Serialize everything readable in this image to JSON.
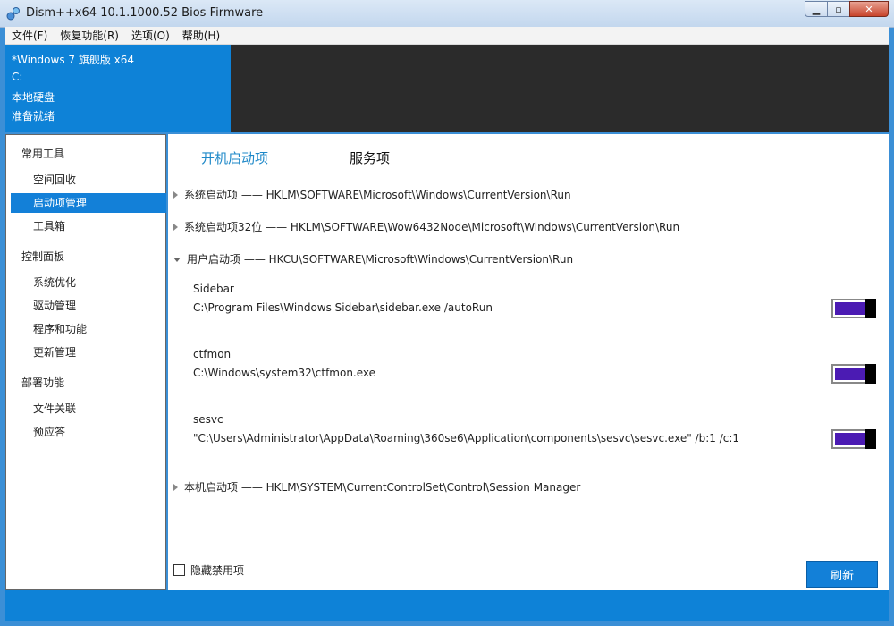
{
  "window": {
    "title": "Dism++x64 10.1.1000.52 Bios Firmware"
  },
  "menu": [
    "文件(F)",
    "恢复功能(R)",
    "选项(O)",
    "帮助(H)"
  ],
  "info": {
    "os": "*Windows 7 旗舰版 x64",
    "drive": "C:",
    "disk": "本地硬盘",
    "status": "准备就绪"
  },
  "sidebar": {
    "sections": [
      {
        "title": "常用工具",
        "items": [
          "空间回收",
          "启动项管理",
          "工具箱"
        ]
      },
      {
        "title": "控制面板",
        "items": [
          "系统优化",
          "驱动管理",
          "程序和功能",
          "更新管理"
        ]
      },
      {
        "title": "部署功能",
        "items": [
          "文件关联",
          "预应答"
        ]
      }
    ],
    "active": "启动项管理"
  },
  "tabs": [
    "开机启动项",
    "服务项"
  ],
  "groups": [
    {
      "label": "系统启动项 —— HKLM\\SOFTWARE\\Microsoft\\Windows\\CurrentVersion\\Run",
      "expanded": false
    },
    {
      "label": "系统启动项32位 —— HKLM\\SOFTWARE\\Wow6432Node\\Microsoft\\Windows\\CurrentVersion\\Run",
      "expanded": false
    },
    {
      "label": "用户启动项 —— HKCU\\SOFTWARE\\Microsoft\\Windows\\CurrentVersion\\Run",
      "expanded": true
    },
    {
      "label": "本机启动项 —— HKLM\\SYSTEM\\CurrentControlSet\\Control\\Session Manager",
      "expanded": false
    }
  ],
  "entries": [
    {
      "name": "Sidebar",
      "command": "C:\\Program Files\\Windows Sidebar\\sidebar.exe /autoRun",
      "enabled": true
    },
    {
      "name": "ctfmon",
      "command": "C:\\Windows\\system32\\ctfmon.exe",
      "enabled": true
    },
    {
      "name": "sesvc",
      "command": "\"C:\\Users\\Administrator\\AppData\\Roaming\\360se6\\Application\\components\\sesvc\\sesvc.exe\" /b:1 /c:1",
      "enabled": true
    }
  ],
  "footer": {
    "hide_disabled": "隐藏禁用项",
    "refresh": "刷新"
  },
  "colors": {
    "accent": "#0e82d7",
    "toggle_on": "#4b1bb3",
    "tab_active": "#1e88c8"
  }
}
